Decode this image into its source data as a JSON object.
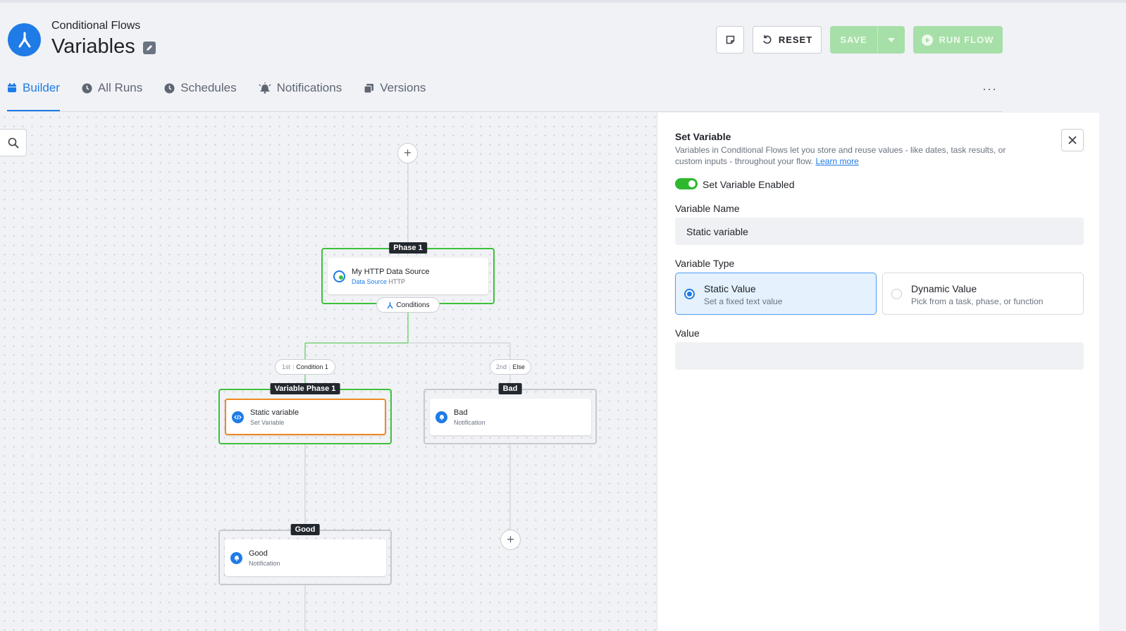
{
  "header": {
    "breadcrumb": "Conditional Flows",
    "title": "Variables",
    "buttons": {
      "reset": "RESET",
      "save": "SAVE",
      "run": "RUN FLOW"
    }
  },
  "tabs": [
    {
      "label": "Builder",
      "icon": "calendar-icon",
      "active": true
    },
    {
      "label": "All Runs",
      "icon": "clock-icon"
    },
    {
      "label": "Schedules",
      "icon": "clock-icon"
    },
    {
      "label": "Notifications",
      "icon": "bell-icon"
    },
    {
      "label": "Versions",
      "icon": "copy-icon"
    }
  ],
  "more": "···",
  "canvas": {
    "plus": "+",
    "phase1": {
      "tag": "Phase 1",
      "node_title": "My HTTP Data Source",
      "node_sub_link": "Data Source",
      "node_sub": "HTTP",
      "conditions": "Conditions"
    },
    "branch1": {
      "ordinal": "1st",
      "label": "Condition 1"
    },
    "branch2": {
      "ordinal": "2nd",
      "label": "Else"
    },
    "var_phase": {
      "tag": "Variable Phase 1",
      "node_title": "Static variable",
      "node_sub": "Set Variable"
    },
    "bad": {
      "tag": "Bad",
      "node_title": "Bad",
      "node_sub": "Notification"
    },
    "good": {
      "tag": "Good",
      "node_title": "Good",
      "node_sub": "Notification"
    }
  },
  "panel": {
    "title": "Set Variable",
    "description": "Variables in Conditional Flows let you store and reuse values - like dates, task results, or custom inputs - throughout your flow.",
    "learn_more": "Learn more",
    "toggle_label": "Set Variable Enabled",
    "toggle_on": true,
    "name_label": "Variable Name",
    "name_value": "Static variable",
    "type_label": "Variable Type",
    "options": [
      {
        "title": "Static Value",
        "sub": "Set a fixed text value",
        "selected": true
      },
      {
        "title": "Dynamic Value",
        "sub": "Pick from a task, phase, or function",
        "selected": false
      }
    ],
    "value_label": "Value",
    "value": ""
  },
  "colors": {
    "accent": "#1f7be6",
    "success": "#3cc13b",
    "selected": "#f08a24"
  }
}
